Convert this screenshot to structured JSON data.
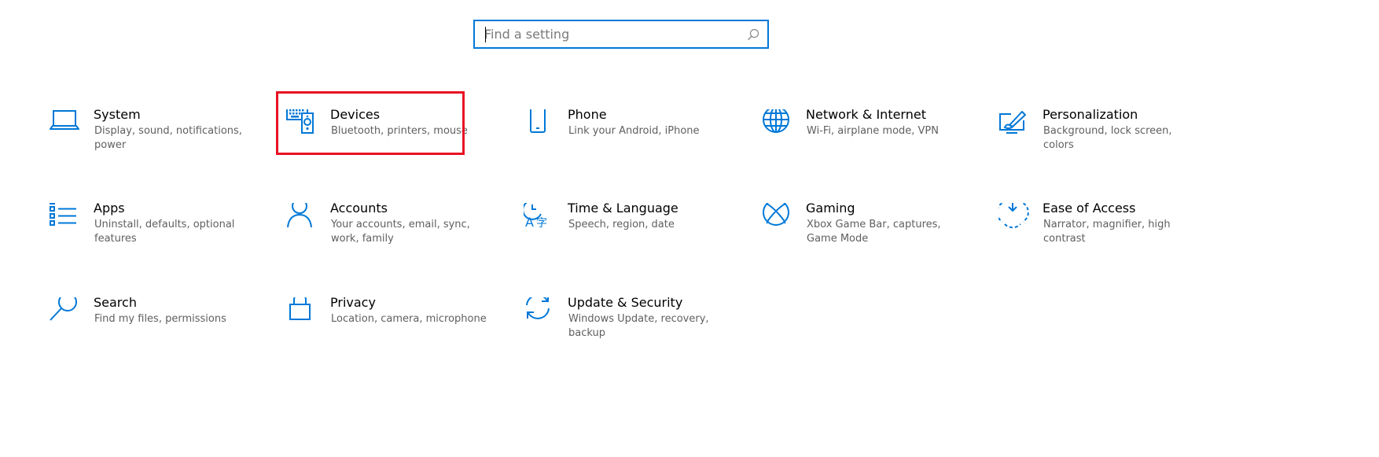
{
  "search": {
    "placeholder": "Find a setting",
    "value": ""
  },
  "accent_color": "#0078d7",
  "highlight_color": "#e81123",
  "categories": [
    {
      "title": "System",
      "desc": "Display, sound, notifications, power",
      "icon": "laptop-icon"
    },
    {
      "title": "Devices",
      "desc": "Bluetooth, printers, mouse",
      "icon": "devices-icon",
      "highlighted": true
    },
    {
      "title": "Phone",
      "desc": "Link your Android, iPhone",
      "icon": "phone-icon"
    },
    {
      "title": "Network & Internet",
      "desc": "Wi-Fi, airplane mode, VPN",
      "icon": "globe-icon"
    },
    {
      "title": "Personalization",
      "desc": "Background, lock screen, colors",
      "icon": "personalization-icon"
    },
    {
      "title": "Apps",
      "desc": "Uninstall, defaults, optional features",
      "icon": "apps-list-icon"
    },
    {
      "title": "Accounts",
      "desc": "Your accounts, email, sync, work, family",
      "icon": "person-icon"
    },
    {
      "title": "Time & Language",
      "desc": "Speech, region, date",
      "icon": "time-language-icon"
    },
    {
      "title": "Gaming",
      "desc": "Xbox Game Bar, captures, Game Mode",
      "icon": "xbox-icon"
    },
    {
      "title": "Ease of Access",
      "desc": "Narrator, magnifier, high contrast",
      "icon": "ease-of-access-icon"
    },
    {
      "title": "Search",
      "desc": "Find my files, permissions",
      "icon": "search-magnifier-icon"
    },
    {
      "title": "Privacy",
      "desc": "Location, camera, microphone",
      "icon": "lock-icon"
    },
    {
      "title": "Update & Security",
      "desc": "Windows Update, recovery, backup",
      "icon": "sync-arrows-icon"
    }
  ]
}
